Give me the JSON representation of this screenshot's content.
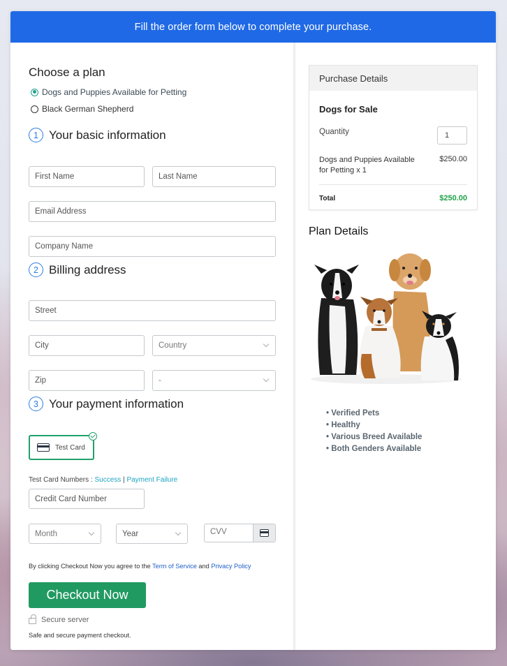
{
  "header": {
    "banner_text": "Fill the order form below to complete your purchase."
  },
  "plan": {
    "title": "Choose a plan",
    "options": [
      {
        "label": "Dogs and Puppies Available for Petting",
        "selected": true
      },
      {
        "label": "Black German Shepherd",
        "selected": false
      }
    ]
  },
  "basic_info": {
    "step": "1",
    "title": "Your basic information",
    "first_name_placeholder": "First Name",
    "last_name_placeholder": "Last Name",
    "email_placeholder": "Email Address",
    "company_placeholder": "Company Name"
  },
  "billing": {
    "step": "2",
    "title": "Billing address",
    "street_placeholder": "Street",
    "city_placeholder": "City",
    "country_selected": "Country",
    "zip_placeholder": "Zip",
    "state_selected": "-"
  },
  "payment": {
    "step": "3",
    "title": "Your payment information",
    "method_label": "Test Card",
    "test_numbers_label": "Test Card Numbers : ",
    "success_link": "Success",
    "separator": " | ",
    "failure_link": "Payment Failure",
    "card_number_placeholder": "Credit Card Number",
    "month_selected": "Month",
    "year_selected": "Year",
    "cvv_placeholder": "CVV"
  },
  "terms": {
    "prefix": "By clicking Checkout Now you agree to the ",
    "tos_link": "Term of Service",
    "and": " and ",
    "privacy_link": "Privacy Policy"
  },
  "checkout": {
    "button_label": "Checkout Now",
    "secure_label": "Secure server",
    "safe_text": "Safe and secure payment checkout."
  },
  "purchase_details": {
    "header": "Purchase Details",
    "product_title": "Dogs for Sale",
    "quantity_label": "Quantity",
    "quantity_value": "1",
    "item_label": "Dogs and Puppies Available for Petting x 1",
    "item_price": "$250.00",
    "total_label": "Total",
    "total_value": "$250.00",
    "total_color": "#20a04a"
  },
  "plan_details": {
    "title": "Plan Details",
    "image_alt": "dogs-group-photo",
    "features": [
      "Verified Pets",
      "Healthy",
      "Various Breed Available",
      "Both Genders Available"
    ]
  },
  "colors": {
    "banner": "#1f69e6",
    "checkout": "#219a62",
    "accent_step": "#2a7de1",
    "radio_selected": "#21a08a"
  }
}
